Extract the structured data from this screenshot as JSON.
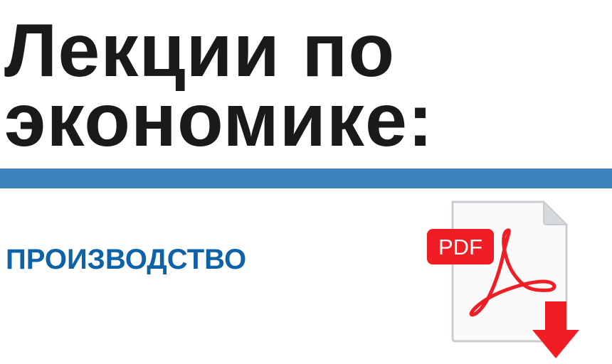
{
  "header": {
    "title_line1": "Лекции по",
    "title_line2": "экономике:"
  },
  "topic": {
    "label": "ПРОИЗВОДСТВО"
  },
  "pdf_icon": {
    "badge_text": "PDF",
    "icon": "pdf-download-icon"
  },
  "colors": {
    "title": "#1a1a1a",
    "divider": "#3d84bf",
    "topic": "#0e63a8",
    "pdf_red": "#f01e24"
  }
}
